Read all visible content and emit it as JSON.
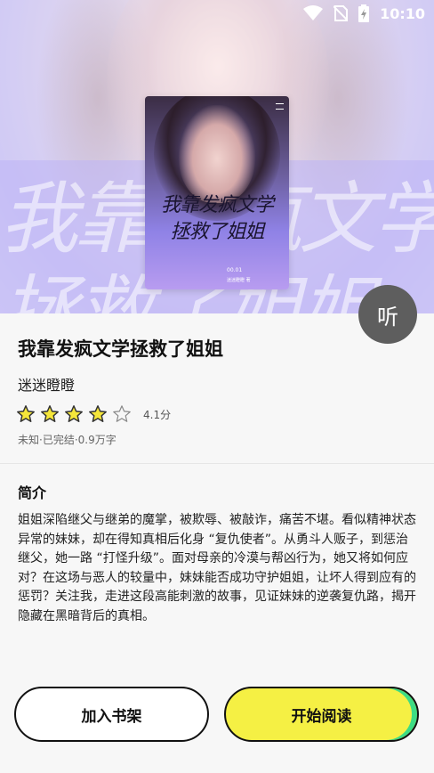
{
  "status_bar": {
    "time": "10:10",
    "icons": [
      "wifi-icon",
      "no-sim-icon",
      "battery-charging-icon"
    ]
  },
  "cover": {
    "title_line1": "我靠发疯文学",
    "title_line2": "拯救了姐姐",
    "code": "00.01",
    "mini": "迷迷瞪瞪 著"
  },
  "listen_button": "听",
  "book": {
    "title": "我靠发疯文学拯救了姐姐",
    "author": "迷迷瞪瞪",
    "rating": {
      "stars_filled": 4,
      "stars_total": 5,
      "score_text": "4.1分"
    },
    "meta": "未知·已完结·0.9万字"
  },
  "synopsis": {
    "heading": "简介",
    "text": "姐姐深陷继父与继弟的魔掌，被欺辱、被敲诈，痛苦不堪。看似精神状态异常的妹妹，却在得知真相后化身 “复仇使者”。从勇斗人贩子，到惩治继父，她一路 “打怪升级”。面对母亲的冷漠与帮凶行为，她又将如何应对？在这场与恶人的较量中，妹妹能否成功守护姐姐，让坏人得到应有的惩罚？关注我，走进这段高能刺激的故事，见证妹妹的逆袭复仇路，揭开隐藏在黑暗背后的真相。"
  },
  "actions": {
    "add_to_shelf": "加入书架",
    "start_reading": "开始阅读"
  },
  "colors": {
    "star": "#f5e63a",
    "read_button": "#f5f044",
    "read_edge": "#3ddc84",
    "listen_button": "#5e5e5e"
  }
}
